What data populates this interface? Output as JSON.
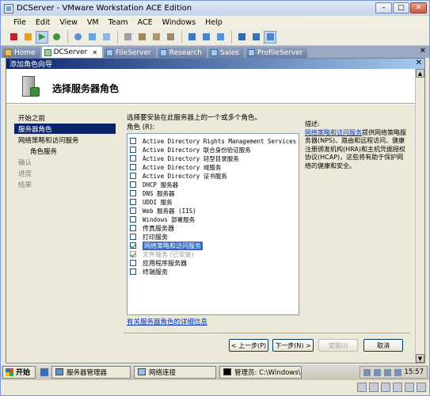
{
  "window": {
    "title": "DCServer - VMware Workstation ACE Edition",
    "controls": {
      "minimize": "–",
      "maximize": "□",
      "close": "✕"
    }
  },
  "menu": [
    "File",
    "Edit",
    "View",
    "VM",
    "Team",
    "ACE",
    "Windows",
    "Help"
  ],
  "tabs": [
    {
      "label": "Home",
      "active": false
    },
    {
      "label": "DCServer",
      "active": true
    },
    {
      "label": "FileServer",
      "active": false
    },
    {
      "label": "Research",
      "active": false
    },
    {
      "label": "Sales",
      "active": false
    },
    {
      "label": "ProfileServer",
      "active": false
    }
  ],
  "tab_close": "✕",
  "dialog": {
    "title": "添加角色向导",
    "close": "✕",
    "heading": "选择服务器角色",
    "nav": [
      {
        "label": "开始之前",
        "state": "normal"
      },
      {
        "label": "服务器角色",
        "state": "active"
      },
      {
        "label": "网络策略和访问服务",
        "state": "normal"
      },
      {
        "label": "角色服务",
        "state": "indent"
      },
      {
        "label": "确认",
        "state": "muted"
      },
      {
        "label": "进度",
        "state": "muted"
      },
      {
        "label": "结果",
        "state": "muted"
      }
    ],
    "instruction": "选择要安装在此服务器上的一个或多个角色。",
    "roles_label": "角色 (R):",
    "roles": [
      {
        "label": "Active Directory Rights Management Services",
        "checked": false,
        "mono": true
      },
      {
        "label": "Active Directory 联合身份验证服务",
        "checked": false,
        "mono": true
      },
      {
        "label": "Active Directory 轻型目录服务",
        "checked": false,
        "mono": true
      },
      {
        "label": "Active Directory 域服务",
        "checked": false,
        "mono": true
      },
      {
        "label": "Active Directory 证书服务",
        "checked": false,
        "mono": true
      },
      {
        "label": "DHCP 服务器",
        "checked": false,
        "mono": true
      },
      {
        "label": "DNS 服务器",
        "checked": false,
        "mono": true
      },
      {
        "label": "UDDI 服务",
        "checked": false,
        "mono": true
      },
      {
        "label": "Web 服务器 (IIS)",
        "checked": false,
        "mono": true
      },
      {
        "label": "Windows 部署服务",
        "checked": false,
        "mono": true
      },
      {
        "label": "传真服务器",
        "checked": false,
        "mono": false
      },
      {
        "label": "打印服务",
        "checked": false,
        "mono": false
      },
      {
        "label": "网络策略和访问服务",
        "checked": true,
        "selected": true,
        "mono": false
      },
      {
        "label": "文件服务  (已安装)",
        "checked": true,
        "disabled": true,
        "mono": false
      },
      {
        "label": "应用程序服务器",
        "checked": false,
        "mono": false
      },
      {
        "label": "终端服务",
        "checked": false,
        "mono": false
      }
    ],
    "more_info_link": "有关服务器角色的详细信息",
    "description": {
      "heading": "描述:",
      "link": "网络策略和访问服务",
      "text": "提供网络策略服务器(NPS)、路由和远程访问、健康注册颁发机构(HRA)和主机凭据授权协议(HCAP)，这些将有助于保护网络的健康和安全。"
    },
    "buttons": {
      "back": "< 上一步(P)",
      "next": "下一步(N) >",
      "install": "安装(I)",
      "cancel": "取消"
    }
  },
  "taskbar": {
    "start": "开始",
    "items": [
      {
        "label": "服务器管理器",
        "pressed": false
      },
      {
        "label": "网络连接",
        "pressed": false
      },
      {
        "label": "管理员: C:\\Windows\\...",
        "pressed": false
      }
    ],
    "time": "15:57"
  },
  "colors": {
    "title_gradient_start": "#0a246a",
    "selection": "#316ac5",
    "link": "#0033cc"
  }
}
